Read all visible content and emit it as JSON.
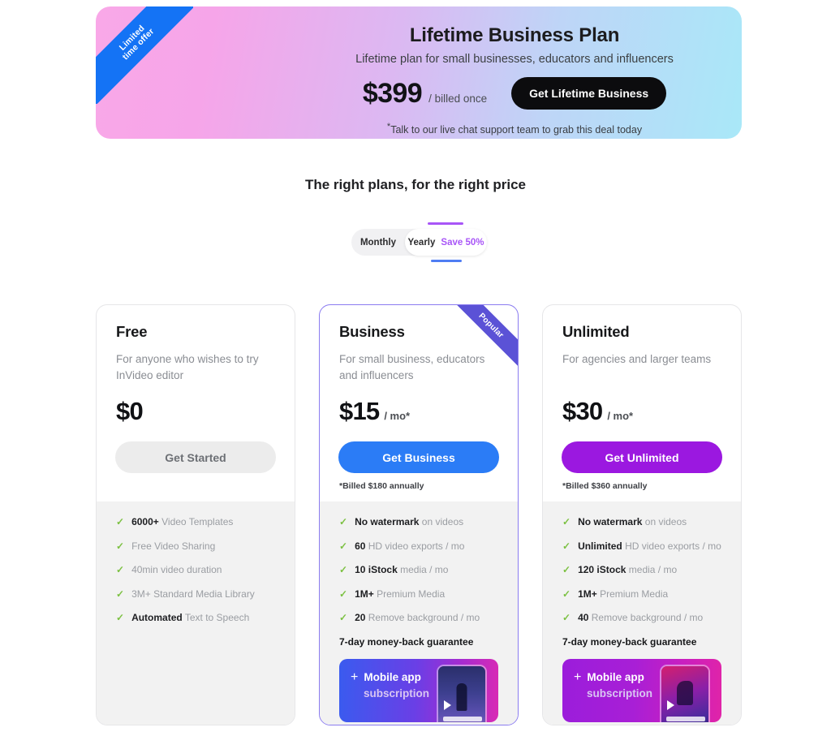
{
  "banner": {
    "ribbon_line1": "Limited",
    "ribbon_line2": "time offer",
    "title": "Lifetime Business Plan",
    "subtitle": "Lifetime plan for small businesses, educators and influencers",
    "price": "$399",
    "period": "/ billed once",
    "cta_label": "Get Lifetime Business",
    "note_marker": "*",
    "note": "Talk to our live chat support team to grab this deal today",
    "accent_blue": "#1473f5"
  },
  "section": {
    "title": "The right plans, for the right price"
  },
  "billing_toggle": {
    "monthly_label": "Monthly",
    "yearly_label": "Yearly",
    "save_label": "Save 50%",
    "selected": "Yearly",
    "save_color": "#a855f7"
  },
  "plans": [
    {
      "name": "Free",
      "description": "For anyone who wishes to try InVideo editor",
      "price": "$0",
      "period": "",
      "cta_label": "Get Started",
      "cta_color": "#ececec",
      "billed_note": "",
      "popular": false,
      "features": [
        {
          "strong": "6000+",
          "rest": "Video Templates"
        },
        {
          "strong": "",
          "rest": "Free Video Sharing"
        },
        {
          "strong": "",
          "rest": "40min video duration"
        },
        {
          "strong": "",
          "rest": "3M+ Standard Media Library"
        },
        {
          "strong": "Automated",
          "rest": "Text to Speech"
        }
      ],
      "guarantee": "",
      "promo": null
    },
    {
      "name": "Business",
      "description": "For small business, educators and influencers",
      "price": "$15",
      "period": "/ mo*",
      "cta_label": "Get Business",
      "cta_color": "#2b7cf6",
      "billed_note": "*Billed $180 annually",
      "popular": true,
      "popular_label": "Popular",
      "features": [
        {
          "strong": "No watermark",
          "rest": "on videos"
        },
        {
          "strong": "60",
          "rest": "HD video exports / mo"
        },
        {
          "strong": "10 iStock",
          "rest": "media / mo"
        },
        {
          "strong": "1M+",
          "rest": "Premium Media"
        },
        {
          "strong": "20",
          "rest": "Remove background / mo"
        }
      ],
      "guarantee": "7-day money-back guarantee",
      "promo": {
        "plus": "+",
        "line1": "Mobile app",
        "line2": "subscription"
      }
    },
    {
      "name": "Unlimited",
      "description": "For agencies and larger teams",
      "price": "$30",
      "period": "/ mo*",
      "cta_label": "Get Unlimited",
      "cta_color": "#9b18e0",
      "billed_note": "*Billed $360 annually",
      "popular": false,
      "features": [
        {
          "strong": "No watermark",
          "rest": "on videos"
        },
        {
          "strong": "Unlimited",
          "rest": "HD video exports / mo"
        },
        {
          "strong": "120 iStock",
          "rest": "media / mo"
        },
        {
          "strong": "1M+",
          "rest": "Premium Media"
        },
        {
          "strong": "40",
          "rest": "Remove background / mo"
        }
      ],
      "guarantee": "7-day money-back guarantee",
      "promo": {
        "plus": "+",
        "line1": "Mobile app",
        "line2": "subscription"
      }
    }
  ],
  "icons": {
    "check": "✓"
  }
}
